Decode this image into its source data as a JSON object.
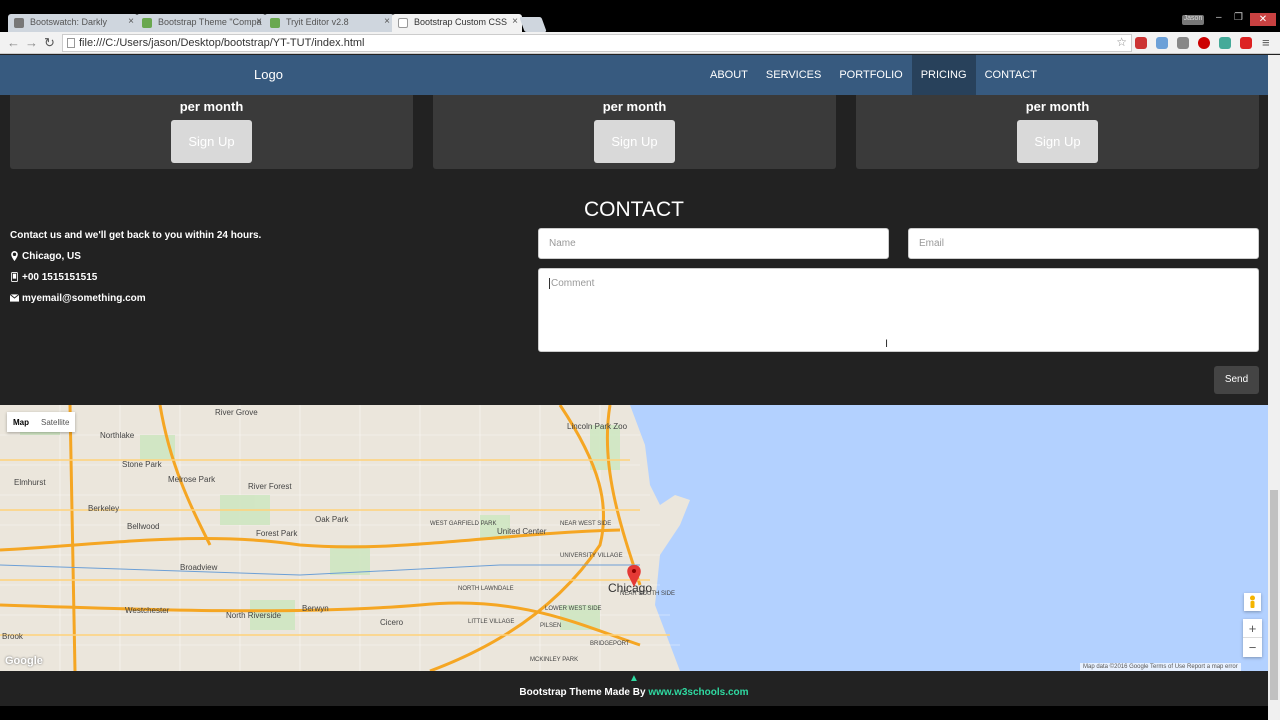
{
  "browser": {
    "tabs": [
      {
        "label": "Bootswatch: Darkly",
        "active": false
      },
      {
        "label": "Bootstrap Theme \"Compa",
        "active": false
      },
      {
        "label": "Tryit Editor v2.8",
        "active": false
      },
      {
        "label": "Bootstrap Custom CSS",
        "active": true
      }
    ],
    "url": "file:///C:/Users/jason/Desktop/bootstrap/YT-TUT/index.html",
    "user_badge": "Jason"
  },
  "navbar": {
    "logo": "Logo",
    "links": [
      "ABOUT",
      "SERVICES",
      "PORTFOLIO",
      "PRICING",
      "CONTACT"
    ],
    "active": "PRICING"
  },
  "pricing": {
    "per_month": "per month",
    "signup_label": "Sign Up"
  },
  "contact": {
    "title": "CONTACT",
    "intro": "Contact us and we'll get back to you within 24 hours.",
    "location": "Chicago, US",
    "phone": "+00 1515151515",
    "email": "myemail@something.com",
    "name_placeholder": "Name",
    "email_placeholder": "Email",
    "comment_placeholder": "Comment",
    "send_label": "Send"
  },
  "map": {
    "type_map": "Map",
    "type_satellite": "Satellite",
    "city_label": "Chicago",
    "attribution": "Map data ©2016 Google   Terms of Use   Report a map error",
    "google": "Google",
    "zoom_in": "+",
    "zoom_out": "−",
    "places": [
      "River Grove",
      "Northlake",
      "Stone Park",
      "Melrose Park",
      "Elmhurst",
      "River Forest",
      "Berkeley",
      "Bellwood",
      "Oak Park",
      "Forest Park",
      "Broadview",
      "Westchester",
      "Berwyn",
      "Cicero",
      "North Riverside",
      "Lincoln Park Zoo",
      "United Center",
      "NEAR WEST SIDE",
      "NEAR SOUTH SIDE",
      "LITTLE VILLAGE",
      "PILSEN",
      "BRIDGEPORT",
      "MCKINLEY PARK",
      "WEST GARFIELD PARK",
      "NORTH LAWNDALE",
      "LOWER WEST SIDE",
      "UNIVERSITY VILLAGE",
      "Brook"
    ]
  },
  "footer": {
    "text": "Bootstrap Theme Made By ",
    "link": "www.w3schools.com"
  }
}
